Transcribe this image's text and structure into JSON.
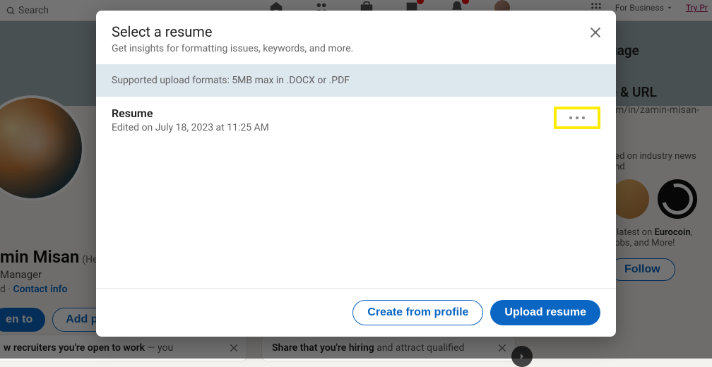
{
  "topbar": {
    "search_placeholder": "Search",
    "for_business_label": "For Business",
    "try_label": "Try Pr"
  },
  "profile": {
    "name": "min Misan",
    "pronoun": "(He",
    "title": " Manager",
    "meta_prefix": "d · ",
    "contact_link": "Contact info",
    "open_to_label": "en to",
    "add_label": "Add pr"
  },
  "cards": {
    "recruiter": {
      "bold": "w recruiters you're open to work",
      "rest": " — you"
    },
    "hiring": {
      "bold": "Share that you're hiring",
      "rest": " and attract qualified"
    }
  },
  "right": {
    "lang_heading": "uage",
    "url_heading": "e & URL",
    "url_value": "om/in/zamin-misan-",
    "ad_top": "ned on industry news and",
    "ad_line_prefix": "e latest on ",
    "ad_line_bold": "Eurocoin",
    "ad_line_suffix": ", Jobs, and More!",
    "follow_label": "Follow"
  },
  "modal": {
    "title": "Select a resume",
    "subtitle": "Get insights for formatting issues, keywords, and more.",
    "banner": "Supported upload formats: 5MB max in .DOCX or .PDF",
    "resume_name": "Resume",
    "resume_meta": "Edited on July 18, 2023 at 11:25 AM",
    "create_label": "Create from profile",
    "upload_label": "Upload resume"
  }
}
